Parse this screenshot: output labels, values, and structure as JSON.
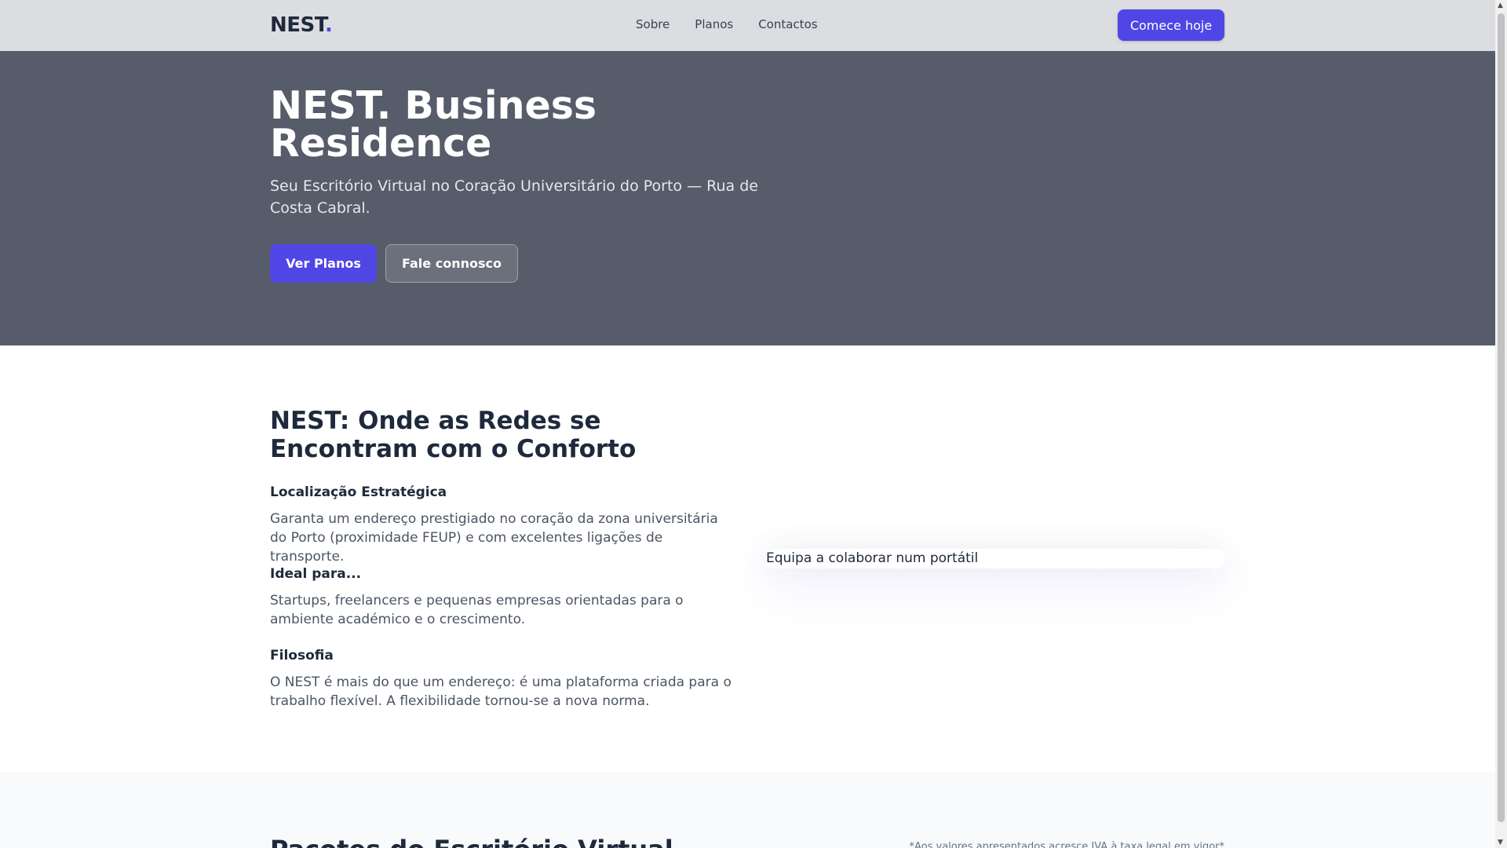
{
  "header": {
    "logo": "NEST",
    "logo_dot": ".",
    "nav": [
      "Sobre",
      "Planos",
      "Contactos"
    ],
    "cta": "Comece hoje"
  },
  "hero": {
    "title": "NEST. Business Residence",
    "subtitle": "Seu Escritório Virtual no Coração Universitário do Porto — Rua de Costa Cabral.",
    "primary": "Ver Planos",
    "secondary": "Fale connosco"
  },
  "about": {
    "title": "NEST: Onde as Redes se Encontram com o Conforto",
    "items": [
      {
        "title": "Localização Estratégica",
        "text": "Garanta um endereço prestigiado no coração da zona universitária do Porto (proximidade FEUP) e com excelentes ligações de transporte."
      },
      {
        "title": "Ideal para...",
        "text": "Startups, freelancers e pequenas empresas orientadas para o ambiente académico e o crescimento."
      },
      {
        "title": "Filosofia",
        "text": "O NEST é mais do que um endereço: é uma plataforma criada para o trabalho flexível. A flexibilidade tornou-se a nova norma."
      }
    ],
    "image_alt": "Equipa a colaborar num portátil"
  },
  "packages": {
    "title": "Pacotes do Escritório Virtual",
    "note": "*Aos valores apresentados acresce IVA à taxa legal em vigor*"
  }
}
